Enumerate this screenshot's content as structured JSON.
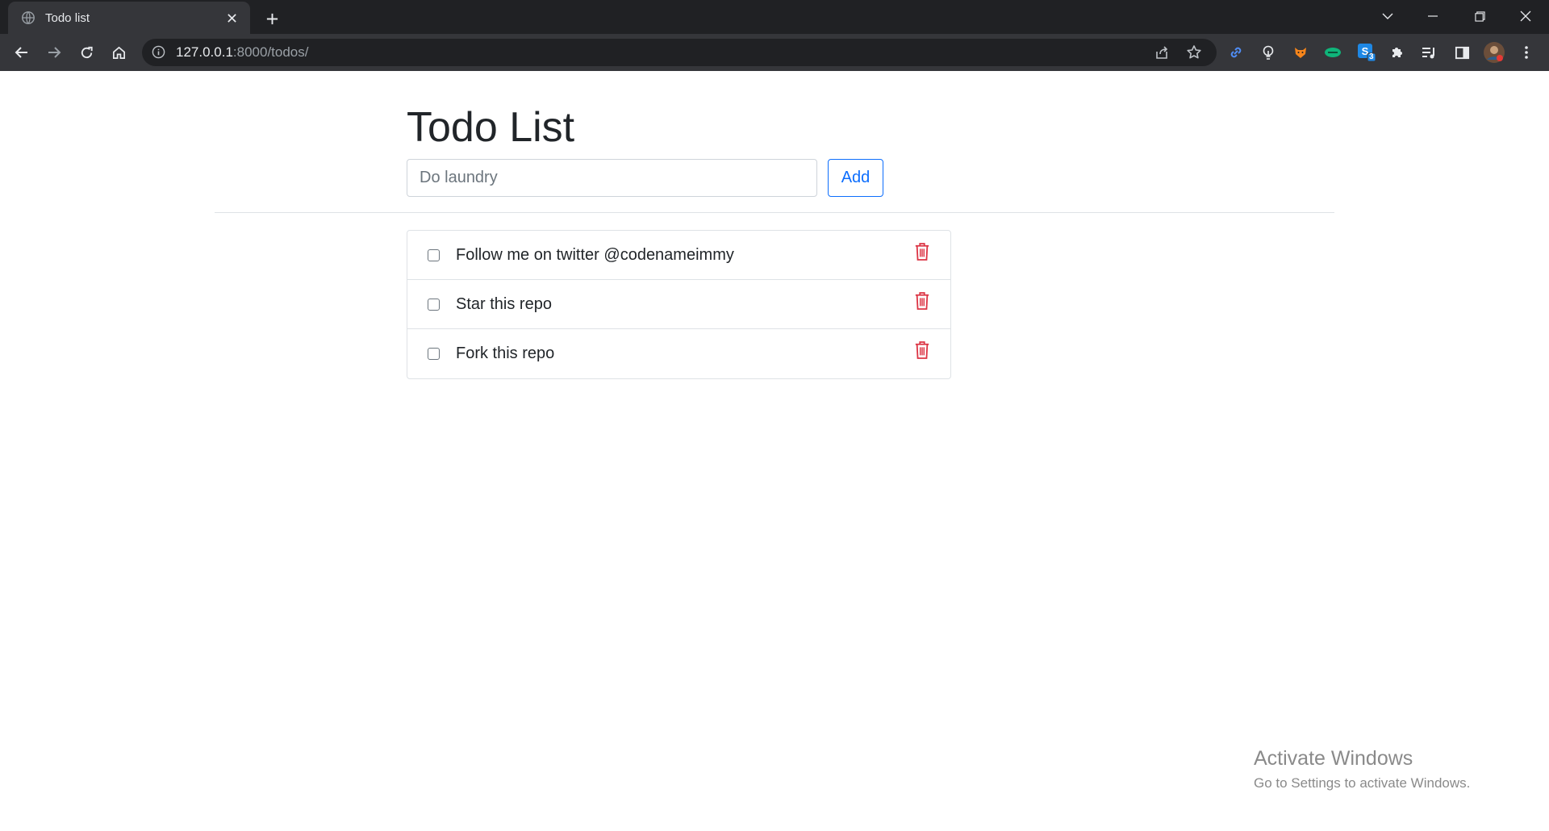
{
  "browser": {
    "tab_title": "Todo list",
    "url_host": "127.0.0.1",
    "url_rest": ":8000/todos/",
    "icons": {
      "favicon": "globe-icon",
      "tab_close": "close-icon",
      "new_tab": "plus-icon",
      "tab_search": "chevron-down-icon",
      "minimize": "minimize-icon",
      "restore": "restore-icon",
      "close_window": "close-icon",
      "back": "arrow-left-icon",
      "forward": "arrow-right-icon",
      "reload": "reload-icon",
      "home": "home-icon",
      "site_info": "info-icon",
      "share": "share-icon",
      "bookmark": "star-icon",
      "extensions": [
        "link-icon",
        "bulb-icon",
        "fox-icon",
        "wallet-icon",
        "skype-icon",
        "puzzle-icon",
        "playlist-icon",
        "side-panel-icon",
        "avatar-icon",
        "kebab-menu-icon"
      ]
    },
    "extension_badge": "3"
  },
  "page": {
    "title": "Todo List",
    "input_placeholder": "Do laundry",
    "add_label": "Add",
    "todos": [
      {
        "text": "Follow me on twitter @codenameimmy",
        "done": false
      },
      {
        "text": "Star this repo",
        "done": false
      },
      {
        "text": "Fork this repo",
        "done": false
      }
    ],
    "delete_icon": "trash-icon",
    "colors": {
      "accent": "#0d6efd",
      "danger": "#dc3545",
      "text": "#212529"
    }
  },
  "watermark": {
    "line1": "Activate Windows",
    "line2": "Go to Settings to activate Windows."
  }
}
